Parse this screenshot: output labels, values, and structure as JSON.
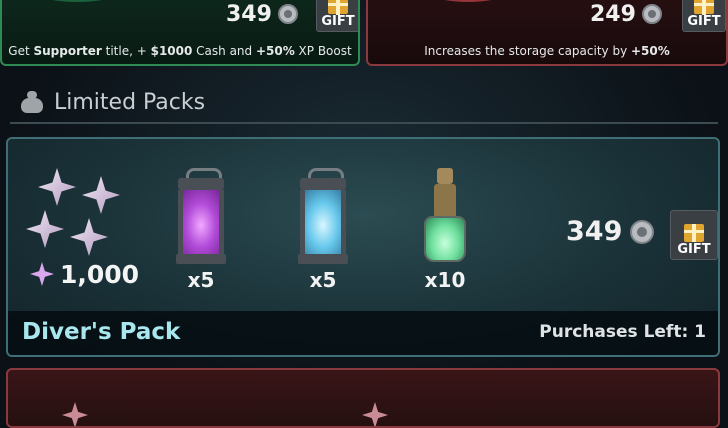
{
  "supporter": {
    "price": "349",
    "gift_label": "GIFT",
    "description_pre": "Get ",
    "description_b1": "Supporter",
    "description_mid1": " title, + ",
    "description_b2": "$1000",
    "description_mid2": " Cash and ",
    "description_b3": "+50%",
    "description_post": " XP Boost"
  },
  "storage": {
    "price": "249",
    "gift_label": "GIFT",
    "description_pre": "Increases the storage capacity by ",
    "description_b1": "+50%"
  },
  "section": {
    "title": "Limited Packs",
    "icon": "money-bag-icon"
  },
  "pack": {
    "name": "Diver's Pack",
    "purchases_left": "Purchases Left: 1",
    "price": "349",
    "gift_label": "GIFT",
    "gems_amount": "1,000",
    "items": [
      {
        "kind": "purple-lantern",
        "qty": "x5"
      },
      {
        "kind": "blue-lantern",
        "qty": "x5"
      },
      {
        "kind": "green-bottle",
        "qty": "x10"
      }
    ]
  },
  "colors": {
    "supporter_border": "#2f8a55",
    "storage_border": "#8a3a3f",
    "pack_border": "#3f6e76",
    "pack_name": "#a9e7ef"
  }
}
